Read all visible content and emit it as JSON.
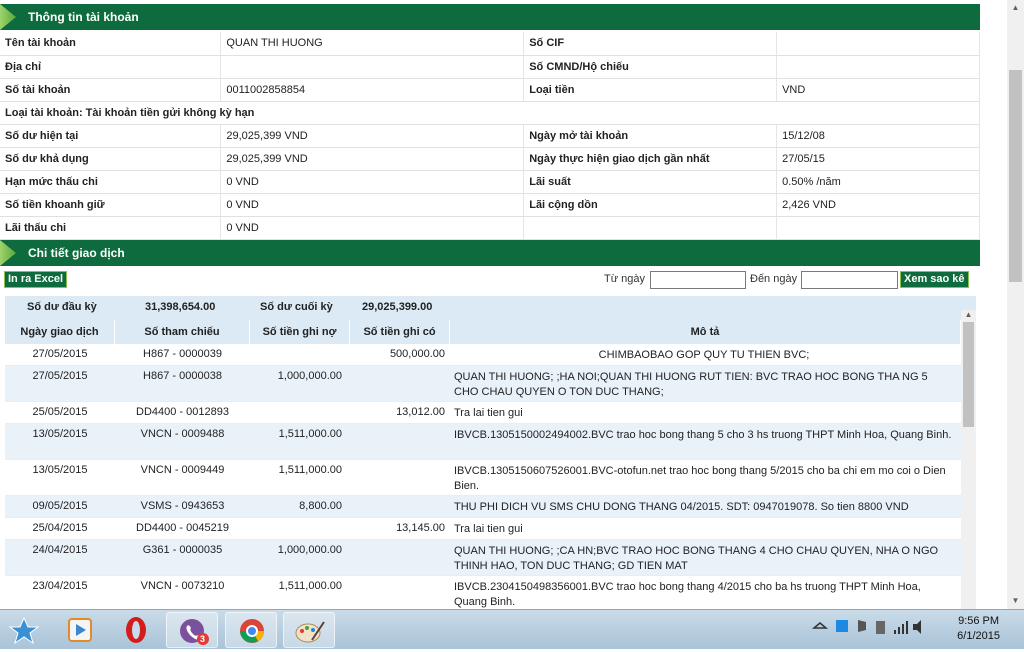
{
  "account_section": {
    "title": "Thông tin tài khoản",
    "rows": [
      {
        "l1": "Tên tài khoản",
        "v1": "QUAN THI HUONG",
        "l2": "Số CIF",
        "v2": ""
      },
      {
        "l1": "Địa chỉ",
        "v1": "",
        "l2": "Số CMND/Hộ chiếu",
        "v2": ""
      },
      {
        "l1": "Số tài khoản",
        "v1": "0011002858854",
        "l2": "Loại tiền",
        "v2": "VND"
      }
    ],
    "account_type": "Loại tài khoản: Tài khoản tiền gửi không kỳ hạn",
    "rows2": [
      {
        "l1": "Số dư hiện tại",
        "v1": "29,025,399 VND",
        "l2": "Ngày mở tài khoản",
        "v2": "15/12/08"
      },
      {
        "l1": "Số dư khả dụng",
        "v1": "29,025,399 VND",
        "l2": "Ngày thực hiện giao dịch gần nhất",
        "v2": "27/05/15"
      },
      {
        "l1": "Hạn mức thấu chi",
        "v1": "0 VND",
        "l2": "Lãi suất",
        "v2": "0.50% /năm"
      },
      {
        "l1": "Số tiền khoanh giữ",
        "v1": "0 VND",
        "l2": "Lãi cộng dồn",
        "v2": "2,426 VND"
      },
      {
        "l1": "Lãi thấu chi",
        "v1": "0 VND",
        "l2": "",
        "v2": ""
      }
    ]
  },
  "transactions_section": {
    "title": "Chi tiết giao dịch",
    "print_excel": "In ra Excel",
    "from_label": "Từ ngày",
    "to_label": "Đến ngày",
    "view_button": "Xem sao kê",
    "opening_label": "Số dư đầu kỳ",
    "opening_value": "31,398,654.00",
    "closing_label": "Số dư cuối kỳ",
    "closing_value": "29,025,399.00",
    "headers": [
      "Ngày giao dịch",
      "Số tham chiếu",
      "Số tiền ghi nợ",
      "Số tiền ghi có",
      "Mô tả"
    ],
    "rows": [
      {
        "date": "27/05/2015",
        "ref": "H867 - 0000039",
        "debit": "",
        "credit": "500,000.00",
        "desc": "CHIMBAOBAO GOP QUY TU THIEN BVC;"
      },
      {
        "date": "27/05/2015",
        "ref": "H867 - 0000038",
        "debit": "1,000,000.00",
        "credit": "",
        "desc": "QUAN THI HUONG; ;HA NOI;QUAN THI HUONG RUT TIEN: BVC TRAO HOC BONG THA NG 5 CHO CHAU QUYEN O TON DUC THANG;"
      },
      {
        "date": "25/05/2015",
        "ref": "DD4400 - 0012893",
        "debit": "",
        "credit": "13,012.00",
        "desc": "Tra lai tien gui"
      },
      {
        "date": "13/05/2015",
        "ref": "VNCN - 0009488",
        "debit": "1,511,000.00",
        "credit": "",
        "desc": "IBVCB.1305150002494002.BVC trao hoc bong thang 5 cho 3 hs truong THPT Minh Hoa, Quang Binh."
      },
      {
        "date": "13/05/2015",
        "ref": "VNCN - 0009449",
        "debit": "1,511,000.00",
        "credit": "",
        "desc": "IBVCB.1305150607526001.BVC-otofun.net trao hoc bong thang 5/2015 cho ba chi em mo coi o Dien Bien."
      },
      {
        "date": "09/05/2015",
        "ref": "VSMS - 0943653",
        "debit": "8,800.00",
        "credit": "",
        "desc": "THU PHI DICH VU SMS CHU DONG THANG 04/2015. SDT: 0947019078. So tien 8800 VND"
      },
      {
        "date": "25/04/2015",
        "ref": "DD4400 - 0045219",
        "debit": "",
        "credit": "13,145.00",
        "desc": "Tra lai tien gui"
      },
      {
        "date": "24/04/2015",
        "ref": "G361 - 0000035",
        "debit": "1,000,000.00",
        "credit": "",
        "desc": "QUAN THI HUONG; ;CA HN;BVC TRAO HOC BONG THANG 4 CHO CHAU QUYEN, NHA O NGO THINH HAO, TON DUC THANG; GD TIEN MAT"
      },
      {
        "date": "23/04/2015",
        "ref": "VNCN - 0073210",
        "debit": "1,511,000.00",
        "credit": "",
        "desc": "IBVCB.2304150498356001.BVC trao hoc bong thang 4/2015 cho ba hs truong THPT Minh Hoa, Quang Binh."
      }
    ]
  },
  "taskbar": {
    "icons": [
      "start-icon",
      "media-player-icon",
      "opera-icon",
      "viber-icon",
      "chrome-icon",
      "paint-icon"
    ],
    "viber_badge": "3",
    "time": "9:56 PM",
    "date": "6/1/2015"
  },
  "colors": {
    "brand_green": "#0d6b3d",
    "table_blue": "#dbeaf5"
  }
}
